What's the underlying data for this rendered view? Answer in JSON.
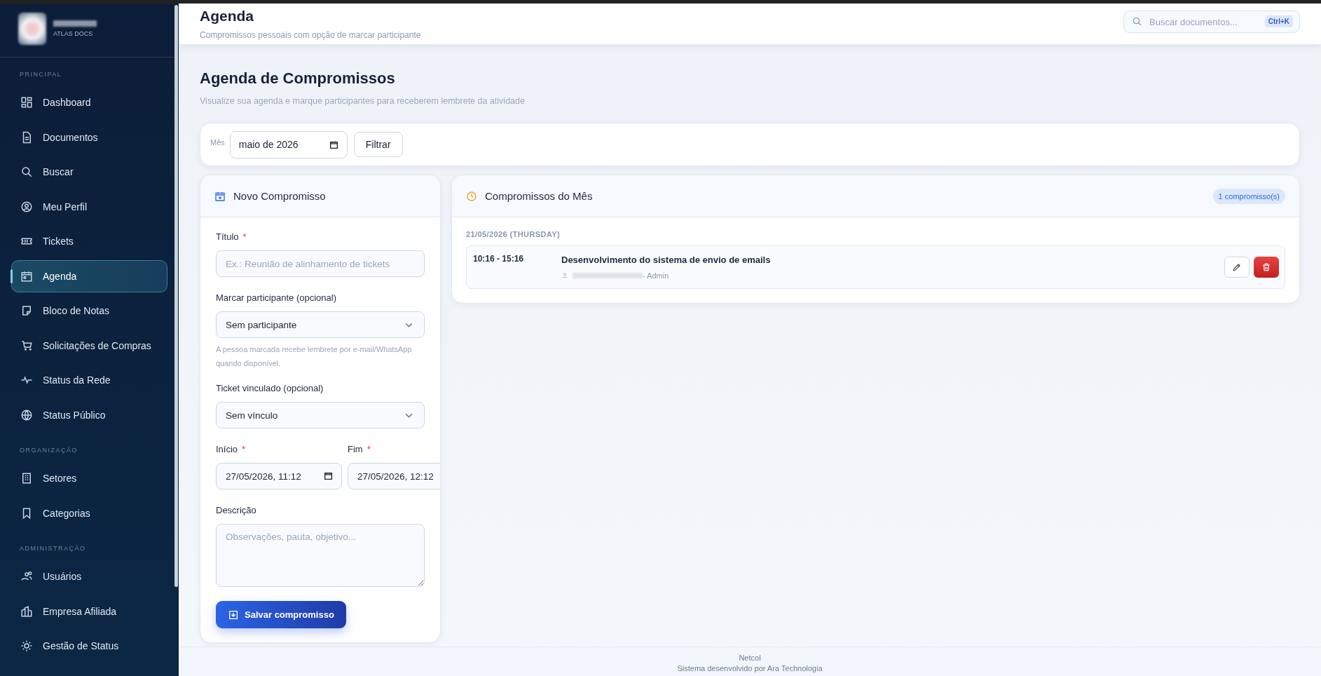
{
  "sidebar": {
    "brand_subtitle": "ATLAS DOCS",
    "sections": [
      {
        "title": "PRINCIPAL",
        "items": [
          {
            "label": "Dashboard",
            "selected": false
          },
          {
            "label": "Documentos",
            "selected": false
          },
          {
            "label": "Buscar",
            "selected": false
          },
          {
            "label": "Meu Perfil",
            "selected": false
          },
          {
            "label": "Tickets",
            "selected": false
          },
          {
            "label": "Agenda",
            "selected": true
          },
          {
            "label": "Bloco de Notas",
            "selected": false
          },
          {
            "label": "Solicitações de Compras",
            "selected": false
          },
          {
            "label": "Status da Rede",
            "selected": false
          },
          {
            "label": "Status Público",
            "selected": false
          }
        ]
      },
      {
        "title": "ORGANIZAÇÃO",
        "items": [
          {
            "label": "Setores",
            "selected": false
          },
          {
            "label": "Categorias",
            "selected": false
          }
        ]
      },
      {
        "title": "ADMINISTRAÇÃO",
        "items": [
          {
            "label": "Usuários",
            "selected": false
          },
          {
            "label": "Empresa Afiliada",
            "selected": false
          },
          {
            "label": "Gestão de Status",
            "selected": false
          }
        ]
      }
    ]
  },
  "header": {
    "title": "Agenda",
    "subtitle": "Compromissos pessoais com opção de marcar participante",
    "search": {
      "placeholder": "Buscar documentos...",
      "shortcut": "Ctrl+K"
    }
  },
  "page": {
    "title": "Agenda de Compromissos",
    "subtitle": "Visualize sua agenda e marque participantes para receberem lembrete da atividade"
  },
  "filter": {
    "label": "Mês",
    "value": "maio de 2026",
    "button": "Filtrar"
  },
  "form": {
    "title": "Novo Compromisso",
    "title_field": {
      "label": "Título",
      "mark": "*",
      "placeholder": "Ex.: Reunião de alinhamento de tickets"
    },
    "participant": {
      "label": "Marcar participante (opcional)",
      "value": "Sem participante",
      "hint": "A pessoa marcada recebe lembrete por e-mail/WhatsApp quando disponível."
    },
    "ticket": {
      "label": "Ticket vinculado (opcional)",
      "value": "Sem vínculo"
    },
    "start": {
      "label": "Início",
      "mark": "*",
      "value": "27/05/2026, 11:12"
    },
    "end": {
      "label": "Fim",
      "mark": "*",
      "value": "27/05/2026, 12:12"
    },
    "description": {
      "label": "Descrição",
      "placeholder": "Observações, pauta, objetivo..."
    },
    "submit": "Salvar compromisso"
  },
  "appointments": {
    "title": "Compromissos do Mês",
    "count": "1 compromisso(s)",
    "days": [
      {
        "date": "21/05/2026 (THURSDAY)",
        "items": [
          {
            "time": "10:16 - 15:16",
            "title": "Desenvolvimento do sistema de envio de emails",
            "participant": "- Admin"
          }
        ]
      }
    ]
  },
  "footer": {
    "lines": [
      "Netcol",
      "Sistema desenvolvido por Ara Technologia"
    ]
  }
}
